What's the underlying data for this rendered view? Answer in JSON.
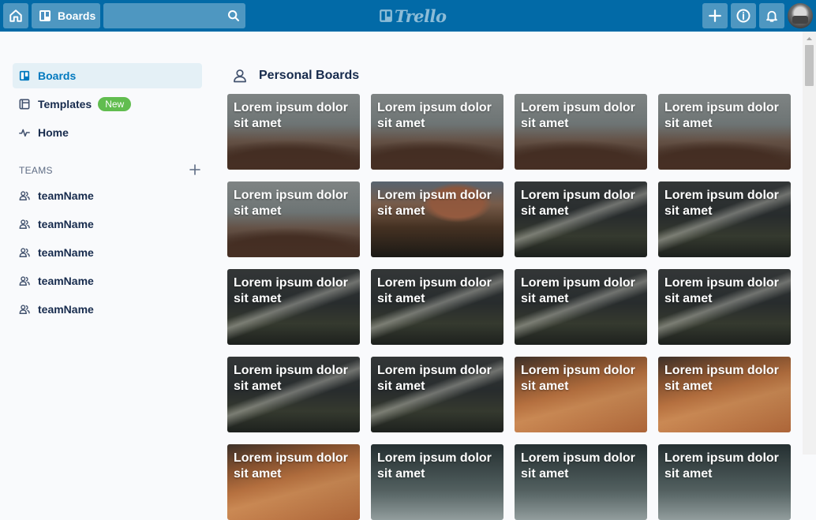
{
  "header": {
    "boards_label": "Boards",
    "search_value": "",
    "logo_text": "Trello"
  },
  "sidebar": {
    "items": [
      {
        "label": "Boards",
        "icon": "board-icon",
        "active": true
      },
      {
        "label": "Templates",
        "icon": "template-icon",
        "badge": "New"
      },
      {
        "label": "Home",
        "icon": "activity-icon"
      }
    ],
    "teams_title": "TEAMS",
    "teams": [
      {
        "label": "teamName"
      },
      {
        "label": "teamName"
      },
      {
        "label": "teamName"
      },
      {
        "label": "teamName"
      },
      {
        "label": "teamName"
      }
    ]
  },
  "main": {
    "section_title": "Personal Boards",
    "boards": [
      {
        "title": "Lorem ipsum dolor sit amet",
        "background": "plant"
      },
      {
        "title": "Lorem ipsum dolor sit amet",
        "background": "plant"
      },
      {
        "title": "Lorem ipsum dolor sit amet",
        "background": "plant"
      },
      {
        "title": "Lorem ipsum dolor sit amet",
        "background": "plant"
      },
      {
        "title": "Lorem ipsum dolor sit amet",
        "background": "plant"
      },
      {
        "title": "Lorem ipsum dolor sit amet",
        "background": "canyon"
      },
      {
        "title": "Lorem ipsum dolor sit amet",
        "background": "light"
      },
      {
        "title": "Lorem ipsum dolor sit amet",
        "background": "light"
      },
      {
        "title": "Lorem ipsum dolor sit amet",
        "background": "light"
      },
      {
        "title": "Lorem ipsum dolor sit amet",
        "background": "light"
      },
      {
        "title": "Lorem ipsum dolor sit amet",
        "background": "light"
      },
      {
        "title": "Lorem ipsum dolor sit amet",
        "background": "light"
      },
      {
        "title": "Lorem ipsum dolor sit amet",
        "background": "light"
      },
      {
        "title": "Lorem ipsum dolor sit amet",
        "background": "light"
      },
      {
        "title": "Lorem ipsum dolor sit amet",
        "background": "dune"
      },
      {
        "title": "Lorem ipsum dolor sit amet",
        "background": "dune"
      },
      {
        "title": "Lorem ipsum dolor sit amet",
        "background": "dune"
      },
      {
        "title": "Lorem ipsum dolor sit amet",
        "background": "river"
      },
      {
        "title": "Lorem ipsum dolor sit amet",
        "background": "river"
      },
      {
        "title": "Lorem ipsum dolor sit amet",
        "background": "river"
      }
    ]
  },
  "colors": {
    "header_bg": "#026aa7",
    "active_nav_bg": "#e4f0f6",
    "active_nav_text": "#0079bf",
    "new_badge": "#61bd4f"
  }
}
